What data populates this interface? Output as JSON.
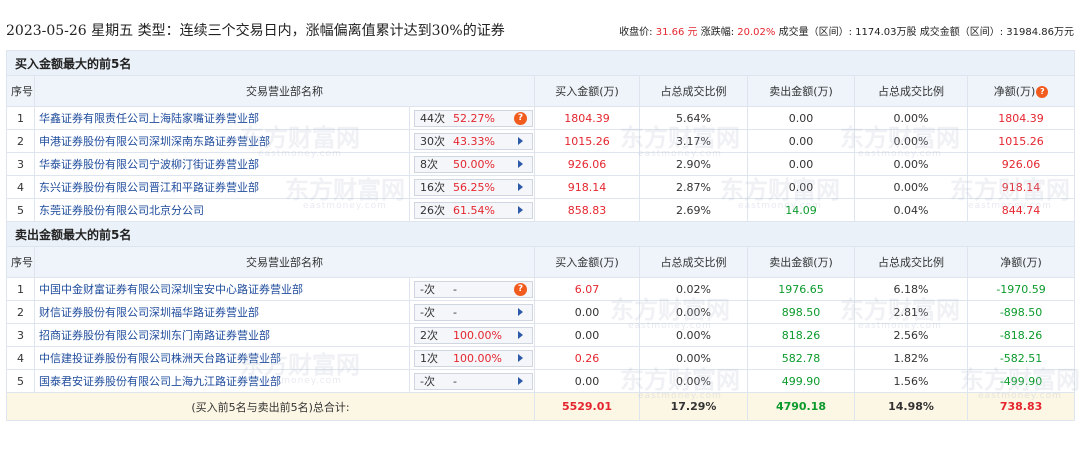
{
  "header": {
    "title": "2023-05-26 星期五 类型：连续三个交易日内，涨幅偏离值累计达到30%的证券",
    "close_label": "收盘价:",
    "close_value": "31.66 元",
    "change_label": "涨跌幅:",
    "change_value": "20.02%",
    "volume_label": "成交量（区间）:",
    "volume_value": "1174.03万股",
    "turnover_label": "成交金额（区间）:",
    "turnover_value": "31984.86万元"
  },
  "watermark": {
    "text": "东方财富网",
    "sub": "eastmoney.com"
  },
  "columns": {
    "rank": "序号",
    "broker": "交易营业部名称",
    "buy": "买入金额(万)",
    "buy_ratio": "占总成交比例",
    "sell": "卖出金额(万)",
    "sell_ratio": "占总成交比例",
    "net": "净额(万)"
  },
  "buy_section": {
    "title": "买入金额最大的前5名",
    "rows": [
      {
        "rank": "1",
        "broker": "华鑫证券有限责任公司上海陆家嘴证券营业部",
        "count": "44次",
        "pct": "52.27%",
        "action": "question-icon",
        "buy": "1804.39",
        "buy_ratio": "5.64%",
        "sell": "0.00",
        "sell_ratio": "0.00%",
        "net": "1804.39"
      },
      {
        "rank": "2",
        "broker": "申港证券股份有限公司深圳深南东路证券营业部",
        "count": "30次",
        "pct": "43.33%",
        "action": "arrow-icon",
        "buy": "1015.26",
        "buy_ratio": "3.17%",
        "sell": "0.00",
        "sell_ratio": "0.00%",
        "net": "1015.26"
      },
      {
        "rank": "3",
        "broker": "华泰证券股份有限公司宁波柳汀街证券营业部",
        "count": "8次",
        "pct": "50.00%",
        "action": "arrow-icon",
        "buy": "926.06",
        "buy_ratio": "2.90%",
        "sell": "0.00",
        "sell_ratio": "0.00%",
        "net": "926.06"
      },
      {
        "rank": "4",
        "broker": "东兴证券股份有限公司晋江和平路证券营业部",
        "count": "16次",
        "pct": "56.25%",
        "action": "arrow-icon",
        "buy": "918.14",
        "buy_ratio": "2.87%",
        "sell": "0.00",
        "sell_ratio": "0.00%",
        "net": "918.14"
      },
      {
        "rank": "5",
        "broker": "东莞证券股份有限公司北京分公司",
        "count": "26次",
        "pct": "61.54%",
        "action": "arrow-icon",
        "buy": "858.83",
        "buy_ratio": "2.69%",
        "sell": "14.09",
        "sell_ratio": "0.04%",
        "net": "844.74"
      }
    ]
  },
  "sell_section": {
    "title": "卖出金额最大的前5名",
    "rows": [
      {
        "rank": "1",
        "broker": "中国中金财富证券有限公司深圳宝安中心路证券营业部",
        "count": "-次",
        "pct": "-",
        "action": "question-icon",
        "buy": "6.07",
        "buy_ratio": "0.02%",
        "sell": "1976.65",
        "sell_ratio": "6.18%",
        "net": "-1970.59"
      },
      {
        "rank": "2",
        "broker": "财信证券股份有限公司深圳福华路证券营业部",
        "count": "-次",
        "pct": "-",
        "action": "arrow-icon",
        "buy": "0.00",
        "buy_ratio": "0.00%",
        "sell": "898.50",
        "sell_ratio": "2.81%",
        "net": "-898.50"
      },
      {
        "rank": "3",
        "broker": "招商证券股份有限公司深圳东门南路证券营业部",
        "count": "2次",
        "pct": "100.00%",
        "action": "arrow-icon",
        "buy": "0.00",
        "buy_ratio": "0.00%",
        "sell": "818.26",
        "sell_ratio": "2.56%",
        "net": "-818.26"
      },
      {
        "rank": "4",
        "broker": "中信建投证券股份有限公司株洲天台路证券营业部",
        "count": "1次",
        "pct": "100.00%",
        "action": "arrow-icon",
        "buy": "0.26",
        "buy_ratio": "0.00%",
        "sell": "582.78",
        "sell_ratio": "1.82%",
        "net": "-582.51"
      },
      {
        "rank": "5",
        "broker": "国泰君安证券股份有限公司上海九江路证券营业部",
        "count": "-次",
        "pct": "-",
        "action": "arrow-icon",
        "buy": "0.00",
        "buy_ratio": "0.00%",
        "sell": "499.90",
        "sell_ratio": "1.56%",
        "net": "-499.90"
      }
    ]
  },
  "total": {
    "label": "(买入前5名与卖出前5名)总合计:",
    "buy": "5529.01",
    "buy_ratio": "17.29%",
    "sell": "4790.18",
    "sell_ratio": "14.98%",
    "net": "738.83"
  },
  "colors": {
    "positive": "#e5262f",
    "negative": "#0b9a2c",
    "link": "#1e4b9c",
    "header_bg": "#eef4fa",
    "total_bg": "#fcf6e4"
  }
}
